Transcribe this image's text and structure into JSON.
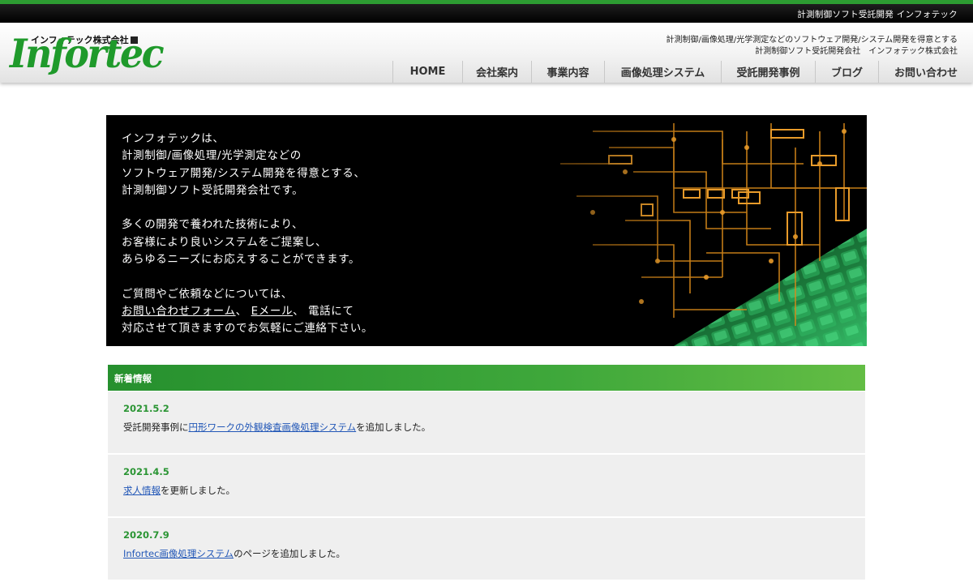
{
  "topbar": {
    "text": "計測制御ソフト受託開発 インフォテック"
  },
  "header": {
    "company_name": "インフォテック株式会社",
    "logo_text": "Infortec",
    "tagline1": "計測制御/画像処理/光学測定などのソフトウェア開発/システム開発を得意とする",
    "tagline2": "計測制御ソフト受託開発会社　インフォテック株式会社"
  },
  "nav": {
    "items": [
      {
        "label": "HOME"
      },
      {
        "label": "会社案内"
      },
      {
        "label": "事業内容"
      },
      {
        "label": "画像処理システム"
      },
      {
        "label": "受託開発事例"
      },
      {
        "label": "ブログ"
      },
      {
        "label": "お問い合わせ"
      }
    ]
  },
  "hero": {
    "para1": [
      "インフォテックは、",
      "計測制御/画像処理/光学測定などの",
      "ソフトウェア開発/システム開発を得意とする、",
      "計測制御ソフト受託開発会社です。"
    ],
    "para2": [
      "多くの開発で養われた技術により、",
      "お客様により良いシステムをご提案し、",
      "あらゆるニーズにお応えすることができます。"
    ],
    "para3_line1": "ご質問やご依頼などについては、",
    "contact_form_link": "お問い合わせフォーム",
    "sep1": "、",
    "email_link": "Eメール",
    "sep2": "、 電話にて",
    "para3_line3": "対応させて頂きますのでお気軽にご連絡下さい。"
  },
  "news": {
    "title": "新着情報",
    "items": [
      {
        "date": "2021.5.2",
        "before": "受託開発事例に",
        "link": "円形ワークの外観検査画像処理システム",
        "after": "を追加しました。"
      },
      {
        "date": "2021.4.5",
        "before": "",
        "link": "求人情報",
        "after": "を更新しました。"
      },
      {
        "date": "2020.7.9",
        "before": "",
        "link": "Infortec画像処理システム",
        "after": "のページを追加しました。"
      }
    ]
  },
  "colors": {
    "brand_green": "#1f9a2b",
    "link_blue": "#2257b7",
    "trace_orange": "#d98a1a"
  }
}
